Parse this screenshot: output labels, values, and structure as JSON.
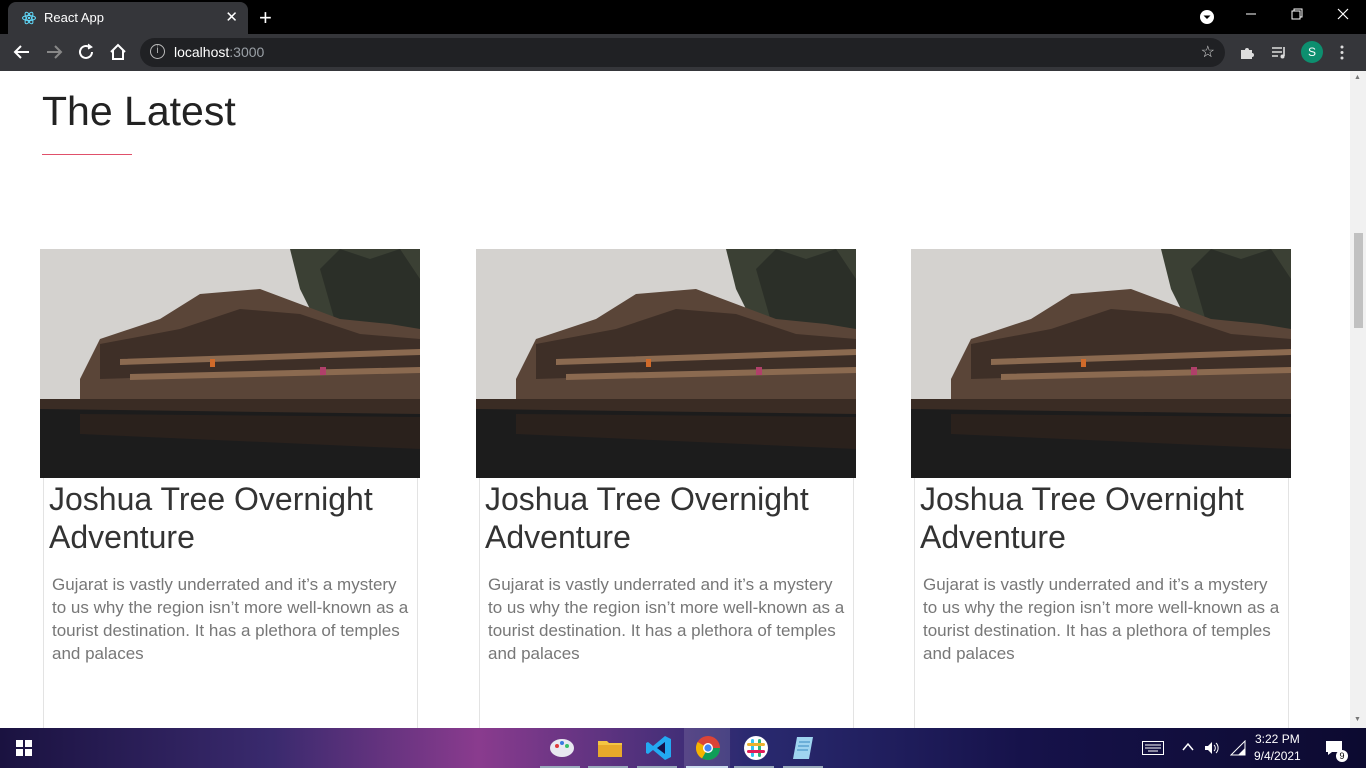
{
  "browser": {
    "tab_title": "React App",
    "tab_close": "✕",
    "new_tab": "+",
    "url_host": "localhost",
    "url_port": ":3000",
    "profile_initial": "S"
  },
  "page": {
    "heading": "The Latest",
    "cards": [
      {
        "title": "Joshua Tree Overnight Adventure",
        "description": "Gujarat is vastly underrated and it’s a mystery to us why the region isn’t more well-known as a tourist destination. It has a plethora of temples and palaces"
      },
      {
        "title": "Joshua Tree Overnight Adventure",
        "description": "Gujarat is vastly underrated and it’s a mystery to us why the region isn’t more well-known as a tourist destination. It has a plethora of temples and palaces"
      },
      {
        "title": "Joshua Tree Overnight Adventure",
        "description": "Gujarat is vastly underrated and it’s a mystery to us why the region isn’t more well-known as a tourist destination. It has a plethora of temples and palaces"
      }
    ]
  },
  "taskbar": {
    "time": "3:22 PM",
    "date": "9/4/2021",
    "notification_count": "9"
  },
  "colors": {
    "accent_underline": "#e0506a",
    "profile_avatar": "#0d8f6f"
  }
}
